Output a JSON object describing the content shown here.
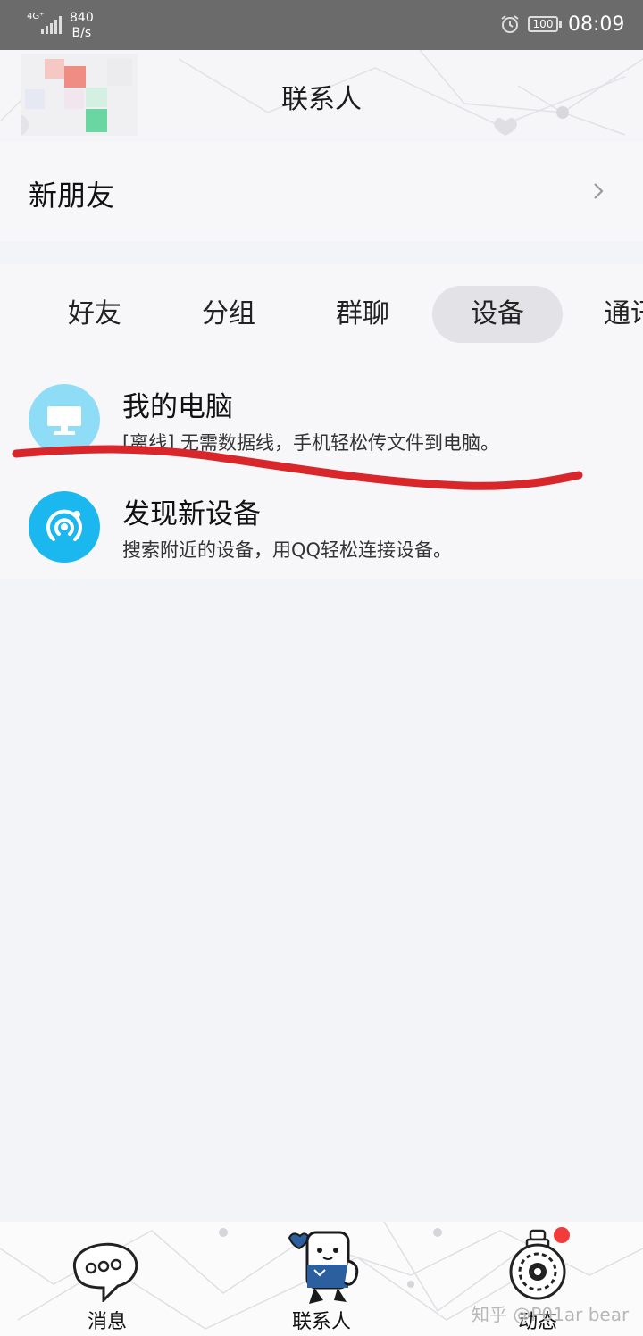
{
  "status_bar": {
    "network": "4G⁺",
    "speed_value": "840",
    "speed_unit": "B/s",
    "battery": "100",
    "time": "08:09"
  },
  "header": {
    "title": "联系人"
  },
  "new_friends": {
    "label": "新朋友"
  },
  "tabs": [
    {
      "label": "好友",
      "active": false
    },
    {
      "label": "分组",
      "active": false
    },
    {
      "label": "群聊",
      "active": false
    },
    {
      "label": "设备",
      "active": true
    },
    {
      "label": "通讯录",
      "active": false
    }
  ],
  "devices": [
    {
      "title": "我的电脑",
      "description": "[离线] 无需数据线，手机轻松传文件到电脑。",
      "icon": "monitor-icon",
      "icon_color": "#8fdcf7"
    },
    {
      "title": "发现新设备",
      "description": "搜索附近的设备，用QQ轻松连接设备。",
      "icon": "radar-icon",
      "icon_color": "#1bb7ef"
    }
  ],
  "bottom_nav": [
    {
      "label": "消息",
      "icon": "message-bubble-icon"
    },
    {
      "label": "联系人",
      "icon": "contacts-character-icon"
    },
    {
      "label": "动态",
      "icon": "dynamic-gear-icon"
    }
  ],
  "watermark": "知乎 @P01ar bear",
  "colors": {
    "annotation_red": "#d8262a",
    "badge_red": "#f23b3b",
    "accent_blue": "#1bb7ef"
  }
}
